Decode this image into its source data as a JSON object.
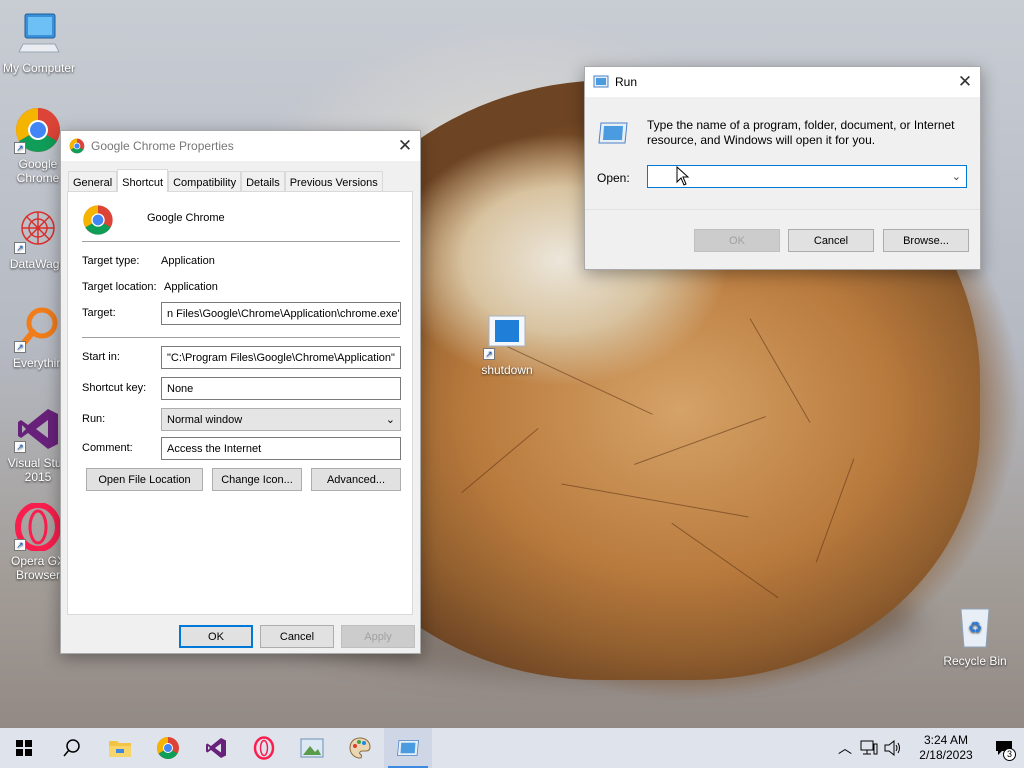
{
  "desktop": {
    "icons": [
      {
        "label": "My Computer"
      },
      {
        "label": "Google\nChrome"
      },
      {
        "label": "DataWago"
      },
      {
        "label": "Everythin"
      },
      {
        "label": "Visual Stud\n2015"
      },
      {
        "label": "Opera GX\nBrowser"
      },
      {
        "label": "Recycle Bin"
      },
      {
        "label": "shutdown"
      }
    ]
  },
  "props_window": {
    "title": "Google Chrome Properties",
    "tabs": [
      "General",
      "Shortcut",
      "Compatibility",
      "Details",
      "Previous Versions"
    ],
    "active_tab": "Shortcut",
    "app_name": "Google Chrome",
    "target_type_label": "Target type:",
    "target_type_value": "Application",
    "target_location_label": "Target location:",
    "target_location_value": "Application",
    "target_label": "Target:",
    "target_value": "n Files\\Google\\Chrome\\Application\\chrome.exe\"",
    "start_in_label": "Start in:",
    "start_in_value": "\"C:\\Program Files\\Google\\Chrome\\Application\"",
    "shortcut_key_label": "Shortcut key:",
    "shortcut_key_value": "None",
    "run_label": "Run:",
    "run_value": "Normal window",
    "comment_label": "Comment:",
    "comment_value": "Access the Internet",
    "open_file_location": "Open File Location",
    "change_icon": "Change Icon...",
    "advanced": "Advanced...",
    "ok": "OK",
    "cancel": "Cancel",
    "apply": "Apply"
  },
  "run_dialog": {
    "title": "Run",
    "description": "Type the name of a program, folder, document, or Internet resource, and Windows will open it for you.",
    "open_label": "Open:",
    "open_value": "",
    "ok": "OK",
    "cancel": "Cancel",
    "browse": "Browse..."
  },
  "taskbar": {
    "time": "3:24 AM",
    "date": "2/18/2023",
    "notification_count": "3"
  },
  "colors": {
    "accent": "#0078d7",
    "taskbar_bg": "#dfe3ec"
  }
}
